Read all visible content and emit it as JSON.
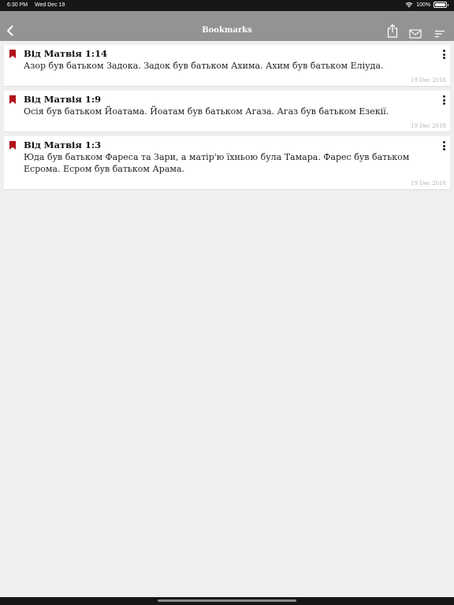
{
  "status": {
    "time": "6:30 PM",
    "date": "Wed Dec 19",
    "battery": "100%"
  },
  "header": {
    "title": "Bookmarks"
  },
  "colors": {
    "bookmark": "#b0131b",
    "nav": "#939393",
    "background": "#efefef"
  },
  "bookmarks": [
    {
      "title": "Від Матвія 1:14",
      "text": "Азор був батьком Задока. Задок був батьком Ахима. Ахим був батьком Еліуда.",
      "date": "19 Dec 2018"
    },
    {
      "title": "Від Матвія 1:9",
      "text": "Осія був батьком Йоатама. Йоатам був батьком Агаза. Агаз був батьком Езекії.",
      "date": "19 Dec 2018"
    },
    {
      "title": "Від Матвія 1:3",
      "text": "Юда був батьком Фареса та Зари, а матір'ю їхньою була Тамара. Фарес був батьком Есрома. Есром був батьком Арама.",
      "date": "19 Dec 2018"
    }
  ]
}
